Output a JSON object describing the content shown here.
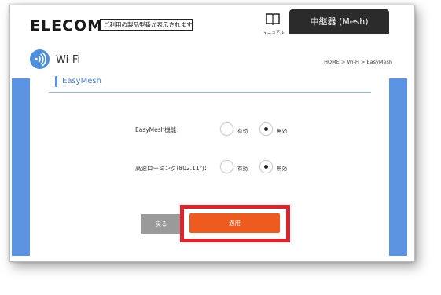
{
  "header": {
    "brand": "ELECOM",
    "model_text": "ご利用の製品型番が表示されます",
    "manual_label": "マニュアル",
    "mode": "中継器 (Mesh)"
  },
  "page": {
    "title": "Wi-Fi",
    "breadcrumb": "HOME > Wi-Fi > EasyMesh"
  },
  "panel": {
    "heading": "EasyMesh",
    "rows": [
      {
        "label": "EasyMesh機能：",
        "option_on": "有効",
        "option_off": "無効",
        "selected": "無効"
      },
      {
        "label": "高速ローミング(802.11r)：",
        "option_on": "有効",
        "option_off": "無効",
        "selected": "無効"
      }
    ]
  },
  "actions": {
    "back_label": "戻る",
    "apply_label": "適用"
  },
  "colors": {
    "accent_blue": "#5c93e3",
    "apply_orange": "#ef5a1f",
    "highlight_red": "#e0222c",
    "mode_dark": "#2b2b2b"
  },
  "icons": {
    "manual": "book-icon",
    "section": "wifi-icon"
  }
}
